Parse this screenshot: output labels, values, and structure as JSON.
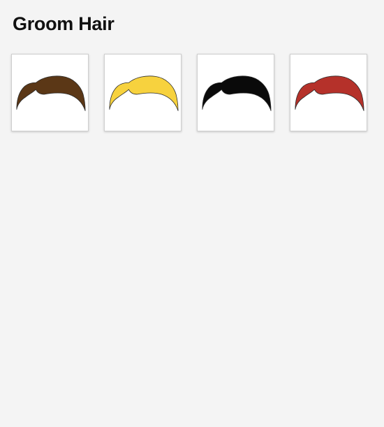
{
  "page": {
    "title": "Groom Hair"
  },
  "hair_options": [
    {
      "color": "#5b3716",
      "icon": "brown-hair-icon"
    },
    {
      "color": "#f7d23e",
      "icon": "blonde-hair-icon"
    },
    {
      "color": "#0a0a0a",
      "icon": "black-hair-icon"
    },
    {
      "color": "#b5312a",
      "icon": "red-hair-icon"
    }
  ]
}
